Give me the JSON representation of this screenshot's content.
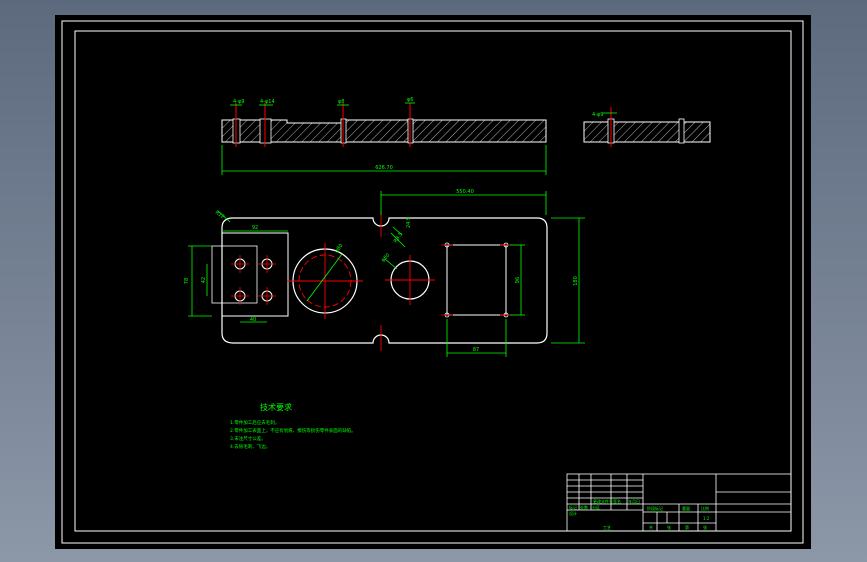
{
  "app": {
    "background_color": "#7a8696",
    "canvas_color": "#000000"
  },
  "colors": {
    "frame": "#ffffff",
    "dimension": "#00ff00",
    "centerline": "#ff0000",
    "hatch": "#ffffff"
  },
  "top_view": {
    "overall_dimension": "626.70",
    "hole_labels": [
      "4-φ9",
      "4-φ14",
      "φ8",
      "φ6"
    ]
  },
  "side_view": {
    "hole_label": "4-φ9"
  },
  "plan_view": {
    "radius_label": "R12",
    "length_dimension": "550.40",
    "height_dimension": "180",
    "circle_dia_label": "φ80",
    "hole_dia_label": "φ60",
    "slot_label": "R8.5",
    "slot_depth": "24.5",
    "plate_width": "92",
    "plate_height": "78",
    "plate_hole_spacing_x": "40",
    "plate_hole_spacing_y": "42",
    "square_height": "96",
    "square_width": "87"
  },
  "notes": {
    "title": "技术要求",
    "lines": [
      "1.零件加工后应去毛刺。",
      "2.零件加工表面上，不应有划痕、擦伤等损伤零件表面的缺陷。",
      "3.未注尺寸公差。",
      "4.去除毛刺、飞边。"
    ]
  },
  "title_block": {
    "row_labels": [
      "标记",
      "处数",
      "分区",
      "更改文件号",
      "签名",
      "年月日"
    ],
    "design_label": "设计",
    "stage_label": "阶段标记",
    "weight_label": "重量",
    "scale_label": "比例",
    "scale_value": "1:2",
    "sheet_labels": [
      "共",
      "张",
      "第",
      "张"
    ],
    "process_label": "工艺"
  }
}
